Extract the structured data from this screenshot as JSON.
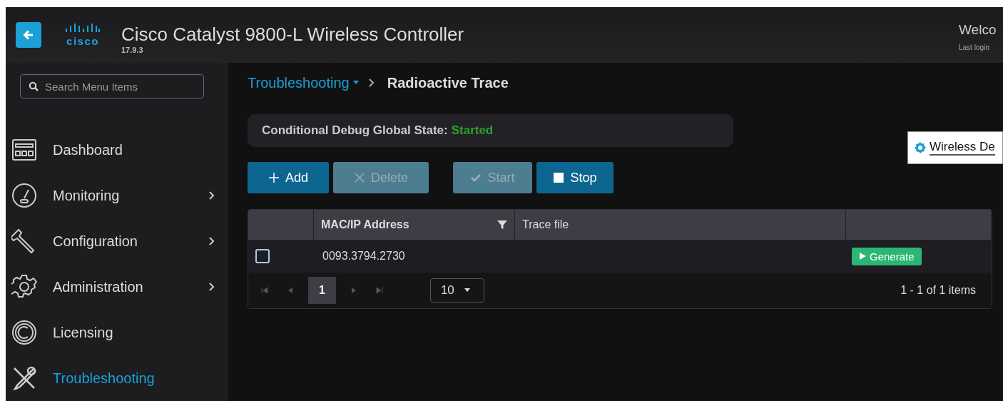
{
  "header": {
    "title": "Cisco Catalyst 9800-L Wireless Controller",
    "version": "17.9.3",
    "logo": "cisco",
    "welcome": "Welco",
    "last_login": "Last login "
  },
  "sidebar": {
    "search": {
      "placeholder": "Search Menu Items"
    },
    "items": [
      {
        "kind": "dashboard",
        "label": "Dashboard",
        "has_submenu": false,
        "selected": false
      },
      {
        "kind": "monitoring",
        "label": "Monitoring",
        "has_submenu": true,
        "selected": false
      },
      {
        "kind": "configuration",
        "label": "Configuration",
        "has_submenu": true,
        "selected": false
      },
      {
        "kind": "administration",
        "label": "Administration",
        "has_submenu": true,
        "selected": false
      },
      {
        "kind": "licensing",
        "label": "Licensing",
        "has_submenu": false,
        "selected": false
      },
      {
        "kind": "troubleshooting",
        "label": "Troubleshooting",
        "has_submenu": false,
        "selected": true
      }
    ]
  },
  "breadcrumb": {
    "parent": "Troubleshooting",
    "current": "Radioactive Trace"
  },
  "global_state": {
    "label": "Conditional Debug Global State:",
    "value": "Started",
    "color": "#2aa12a"
  },
  "side_panel": {
    "label": "Wireless De"
  },
  "buttons": [
    {
      "kind": "plus",
      "label": "Add",
      "disabled": false
    },
    {
      "kind": "cross",
      "label": "Delete",
      "disabled": true
    },
    {
      "kind": "check",
      "label": "Start",
      "disabled": true
    },
    {
      "kind": "square",
      "label": "Stop",
      "disabled": false
    }
  ],
  "table": {
    "columns": [
      {
        "label": "MAC/IP Address",
        "filter": true
      },
      {
        "label": "Trace file",
        "filter": false
      }
    ],
    "rows": [
      {
        "checked": false,
        "address": "0093.3794.2730",
        "action": "Generate"
      }
    ],
    "pager": {
      "page": "1",
      "page_size": "10",
      "summary": "1 - 1 of 1 items"
    }
  }
}
